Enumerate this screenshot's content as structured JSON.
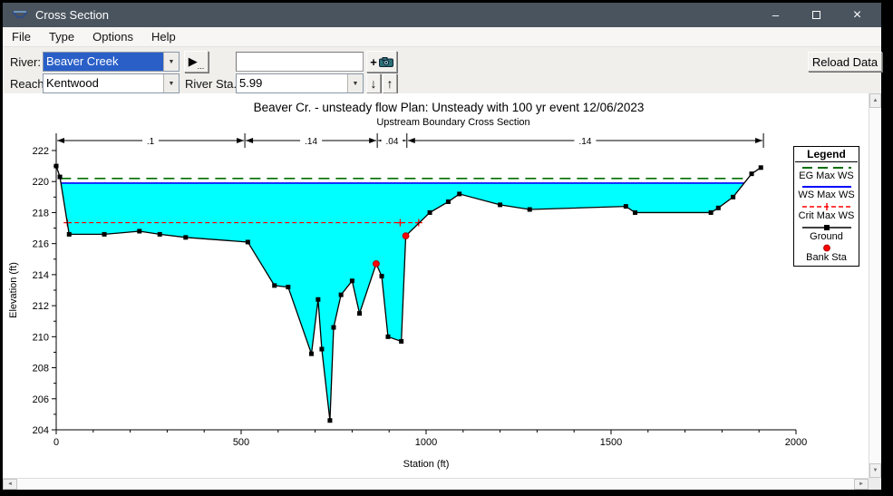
{
  "window": {
    "title": "Cross Section",
    "controls": {
      "minimize": "–",
      "close": "×"
    }
  },
  "menu": {
    "items": [
      "File",
      "Type",
      "Options",
      "Help"
    ]
  },
  "toolbar": {
    "river_label": "River:",
    "river_value": "Beaver Creek",
    "reach_label": "Reach:",
    "reach_value": "Kentwood",
    "river_sta_label": "River Sta.:",
    "river_sta_value": "5.99",
    "text_field_value": "",
    "reload_button": "Reload Data",
    "icons": {
      "dropdown": "▼",
      "plot_arrow": "▶",
      "plot_dots": "...",
      "plus": "+",
      "down_arrow": "↓",
      "up_arrow": "↑",
      "scroll_up": "▲",
      "scroll_down": "▼",
      "scroll_left": "◄",
      "scroll_right": "►"
    }
  },
  "chart_data": {
    "type": "line",
    "title_parts": [
      "Beaver Cr. - unsteady flow",
      "Plan: Unsteady with 100 yr event",
      "12/06/2023"
    ],
    "subtitle": "Upstream Boundary Cross Section",
    "xlabel": "Station (ft)",
    "ylabel": "Elevation (ft)",
    "xlim": [
      0,
      2000
    ],
    "ylim": [
      204,
      222
    ],
    "xticks": [
      0,
      500,
      1000,
      1500,
      2000
    ],
    "x_minor_step": 100,
    "yticks": [
      204,
      206,
      208,
      210,
      212,
      214,
      216,
      218,
      220,
      222
    ],
    "y_minor_step": 1,
    "n_values": [
      {
        "label": ".1",
        "from": 0,
        "to": 510
      },
      {
        "label": ".14",
        "from": 510,
        "to": 868
      },
      {
        "label": ".04",
        "from": 868,
        "to": 948
      },
      {
        "label": ".14",
        "from": 948,
        "to": 1912
      }
    ],
    "series": {
      "ground": {
        "name": "Ground",
        "color": "#000000",
        "points": [
          [
            0,
            221.0
          ],
          [
            10,
            220.3
          ],
          [
            35,
            216.6
          ],
          [
            130,
            216.6
          ],
          [
            225,
            216.8
          ],
          [
            280,
            216.6
          ],
          [
            350,
            216.4
          ],
          [
            518,
            216.1
          ],
          [
            590,
            213.3
          ],
          [
            627,
            213.2
          ],
          [
            690,
            208.9
          ],
          [
            708,
            212.4
          ],
          [
            718,
            209.2
          ],
          [
            740,
            204.6
          ],
          [
            750,
            210.6
          ],
          [
            770,
            212.7
          ],
          [
            800,
            213.6
          ],
          [
            820,
            211.5
          ],
          [
            865,
            214.7
          ],
          [
            880,
            213.9
          ],
          [
            897,
            210.0
          ],
          [
            933,
            209.7
          ],
          [
            945,
            216.5
          ],
          [
            1010,
            218.0
          ],
          [
            1060,
            218.7
          ],
          [
            1090,
            219.2
          ],
          [
            1200,
            218.5
          ],
          [
            1280,
            218.2
          ],
          [
            1540,
            218.4
          ],
          [
            1565,
            218.0
          ],
          [
            1770,
            218.0
          ],
          [
            1790,
            218.3
          ],
          [
            1830,
            219.0
          ],
          [
            1880,
            220.5
          ],
          [
            1905,
            220.9
          ]
        ]
      },
      "eg_max_ws": {
        "name": "EG Max WS",
        "color": "#006e00",
        "elevation": 220.2,
        "style": "long-dash"
      },
      "ws_max_ws": {
        "name": "WS Max WS",
        "color": "#0000ff",
        "elevation": 219.9,
        "style": "solid"
      },
      "crit_max_ws": {
        "name": "Crit Max WS",
        "color": "#ff0000",
        "elevation": 217.35,
        "style": "dash-plus",
        "plus_marker_stations": [
          30,
          930,
          980
        ]
      },
      "bank_sta": {
        "name": "Bank Sta",
        "color": "#ff0000",
        "points": [
          [
            865,
            214.7
          ],
          [
            945,
            216.5
          ]
        ]
      }
    },
    "water_fill_color": "#00ffff",
    "legend": {
      "title": "Legend",
      "entries": [
        "EG Max WS",
        "WS Max WS",
        "Crit Max WS",
        "Ground",
        "Bank Sta"
      ]
    }
  }
}
